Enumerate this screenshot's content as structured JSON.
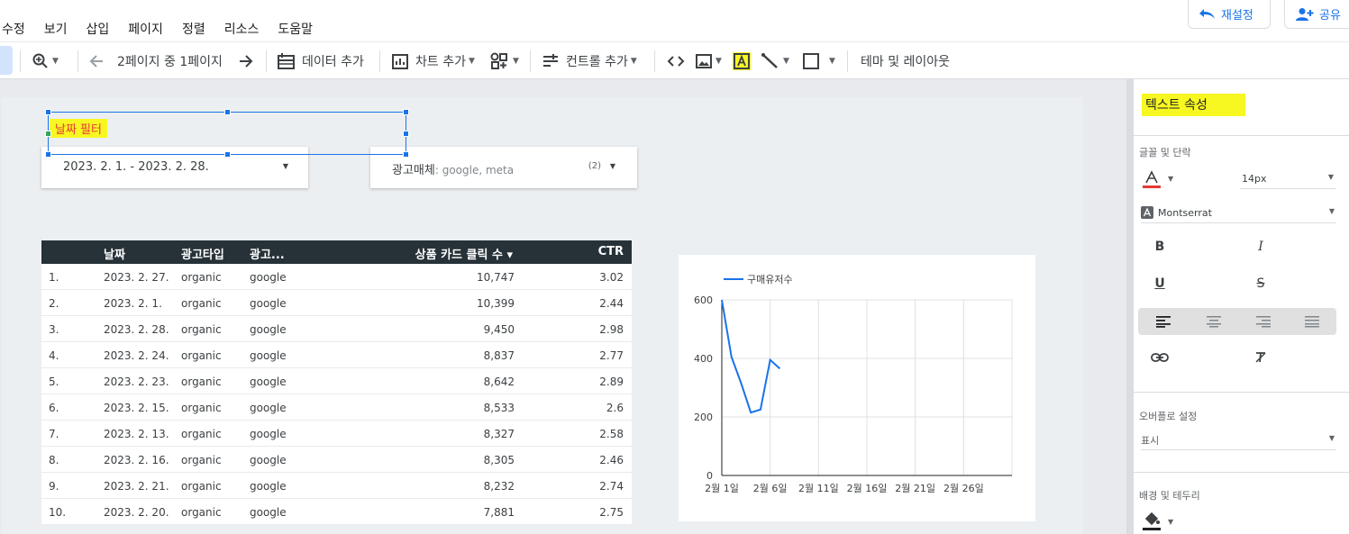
{
  "menu": {
    "items": [
      "수정",
      "보기",
      "삽입",
      "페이지",
      "정렬",
      "리소스",
      "도움말"
    ]
  },
  "header": {
    "reset_label": "재설정",
    "share_label": "공유"
  },
  "toolbar": {
    "page_indicator": "2페이지 중 1페이지",
    "add_data": "데이터 추가",
    "add_chart": "차트 추가",
    "add_control": "컨트롤 추가",
    "theme_layout": "테마 및 레이아웃"
  },
  "canvas": {
    "text_box": "날짜 필터",
    "date_range": "2023. 2. 1. - 2023. 2. 28.",
    "media_filter": {
      "label": "광고매체",
      "value": ": google, meta",
      "count": "(2)"
    }
  },
  "table": {
    "headers": [
      "날짜",
      "광고타입",
      "광고...",
      "상품 카드 클릭 수 ▾",
      "CTR"
    ],
    "rows": [
      [
        "1.",
        "2023. 2. 27.",
        "organic",
        "google",
        "10,747",
        "3.02"
      ],
      [
        "2.",
        "2023. 2. 1.",
        "organic",
        "google",
        "10,399",
        "2.44"
      ],
      [
        "3.",
        "2023. 2. 28.",
        "organic",
        "google",
        "9,450",
        "2.98"
      ],
      [
        "4.",
        "2023. 2. 24.",
        "organic",
        "google",
        "8,837",
        "2.77"
      ],
      [
        "5.",
        "2023. 2. 23.",
        "organic",
        "google",
        "8,642",
        "2.89"
      ],
      [
        "6.",
        "2023. 2. 15.",
        "organic",
        "google",
        "8,533",
        "2.6"
      ],
      [
        "7.",
        "2023. 2. 13.",
        "organic",
        "google",
        "8,327",
        "2.58"
      ],
      [
        "8.",
        "2023. 2. 16.",
        "organic",
        "google",
        "8,305",
        "2.46"
      ],
      [
        "9.",
        "2023. 2. 21.",
        "organic",
        "google",
        "8,232",
        "2.74"
      ],
      [
        "10.",
        "2023. 2. 20.",
        "organic",
        "google",
        "7,881",
        "2.75"
      ]
    ]
  },
  "chart_data": {
    "type": "line",
    "legend": "top-left",
    "series": [
      {
        "name": "구매유저수",
        "color": "#1a73e8",
        "x": [
          1,
          2,
          3,
          4,
          5,
          6,
          7
        ],
        "values": [
          600,
          405,
          315,
          215,
          225,
          395,
          365
        ]
      }
    ],
    "xticks": [
      "2월 1일",
      "2월 6일",
      "2월 11일",
      "2월 16일",
      "2월 21일",
      "2월 26일"
    ],
    "xtick_values": [
      1,
      6,
      11,
      16,
      21,
      26
    ],
    "xlim": [
      1,
      31
    ],
    "yticks": [
      "0",
      "200",
      "400",
      "600"
    ],
    "ylim": [
      0,
      600
    ],
    "grid": true
  },
  "panel": {
    "title": "텍스트 속성",
    "font_section": "글꼴 및 단락",
    "font_size": "14px",
    "font_family": "Montserrat",
    "overflow_section": "오버플로 설정",
    "overflow_value": "표시",
    "bg_section": "배경 및 테두리"
  },
  "colors": {
    "accent": "#1a73e8",
    "highlight": "#f7f722",
    "table_header": "#263238",
    "font_color": "#e53935"
  }
}
